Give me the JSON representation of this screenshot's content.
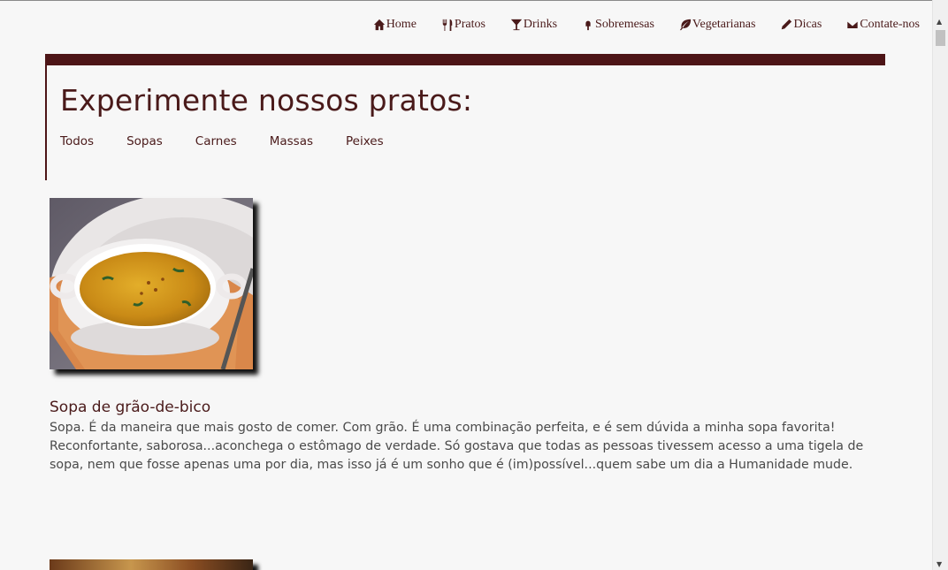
{
  "nav": {
    "items": [
      {
        "label": "Home",
        "icon": "home-icon"
      },
      {
        "label": "Pratos",
        "icon": "fork-knife-icon"
      },
      {
        "label": "Drinks",
        "icon": "cocktail-icon"
      },
      {
        "label": "Sobremesas",
        "icon": "ice-cream-icon"
      },
      {
        "label": "Vegetarianas",
        "icon": "leaf-icon"
      },
      {
        "label": "Dicas",
        "icon": "pencil-icon"
      },
      {
        "label": "Contate-nos",
        "icon": "envelope-icon"
      }
    ]
  },
  "header": {
    "title": "Experimente nossos pratos:",
    "filters": [
      "Todos",
      "Sopas",
      "Carnes",
      "Massas",
      "Peixes"
    ]
  },
  "recipes": [
    {
      "title": "Sopa de grão-de-bico",
      "text": "Sopa. É da maneira que mais gosto de comer. Com grão. É uma combinação perfeita, e é sem dúvida a minha sopa favorita! Reconfortante, saborosa...aconchega o estômago de verdade. Só gostava que todas as pessoas tivessem acesso a uma tigela de sopa, nem que fosse apenas uma por dia, mas isso já é um sonho que é (im)possível...quem sabe um dia a Humanidade mude."
    }
  ],
  "colors": {
    "accent": "#4d1517",
    "background": "#f7f7f7"
  }
}
